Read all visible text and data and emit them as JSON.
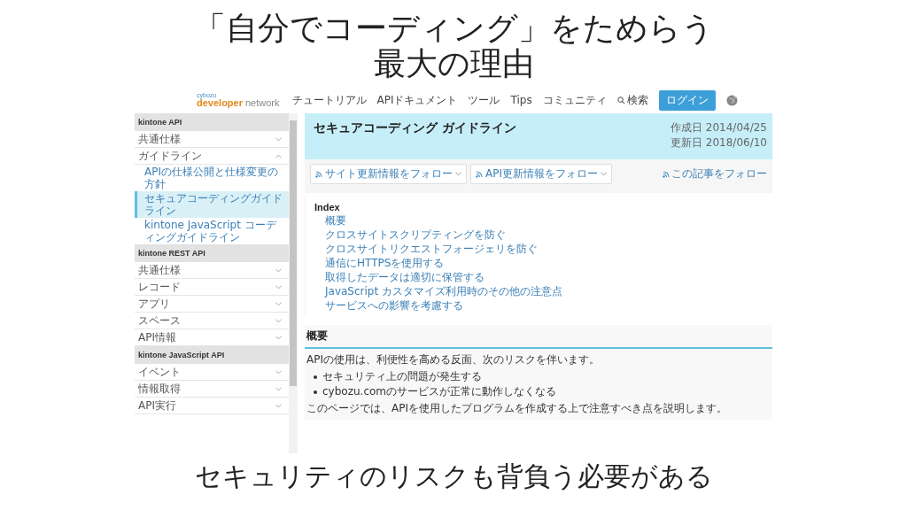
{
  "slide": {
    "title_lines": [
      "「自分でコーディング」をためらう",
      "最大の理由"
    ],
    "caption": "セキュリティのリスクも背負う必要がある"
  },
  "site": {
    "logo": {
      "company": "cybozu",
      "brand": "developer",
      "suffix": "network"
    },
    "nav": [
      "チュートリアル",
      "APIドキュメント",
      "ツール",
      "Tips",
      "コミュニティ"
    ],
    "search": "検索",
    "login": "ログイン"
  },
  "sidebar": [
    {
      "kind": "section",
      "label": "kintone API"
    },
    {
      "kind": "item",
      "label": "共通仕様",
      "expanded": false
    },
    {
      "kind": "item",
      "label": "ガイドライン",
      "expanded": true,
      "children": [
        {
          "label": "APIの仕様公開と仕様変更の方針",
          "selected": false
        },
        {
          "label": "セキュアコーディングガイドライン",
          "selected": true
        },
        {
          "label": "kintone JavaScript コーディングガイドライン",
          "selected": false
        }
      ]
    },
    {
      "kind": "section",
      "label": "kintone REST API"
    },
    {
      "kind": "item",
      "label": "共通仕様",
      "expanded": false
    },
    {
      "kind": "item",
      "label": "レコード",
      "expanded": false
    },
    {
      "kind": "item",
      "label": "アプリ",
      "expanded": false
    },
    {
      "kind": "item",
      "label": "スペース",
      "expanded": false
    },
    {
      "kind": "item",
      "label": "API情報",
      "expanded": false
    },
    {
      "kind": "section",
      "label": "kintone JavaScript API"
    },
    {
      "kind": "item",
      "label": "イベント",
      "expanded": false
    },
    {
      "kind": "item",
      "label": "情報取得",
      "expanded": false
    },
    {
      "kind": "item",
      "label": "API実行",
      "expanded": false
    }
  ],
  "article": {
    "title": "セキュアコーディング ガイドライン",
    "created": "作成日 2014/04/25",
    "updated": "更新日 2018/06/10",
    "follow_buttons": [
      "サイト更新情報をフォロー",
      "API更新情報をフォロー"
    ],
    "follow_article": "この記事をフォロー",
    "index_title": "Index",
    "index": [
      "概要",
      "クロスサイトスクリプティングを防ぐ",
      "クロスサイトリクエストフォージェリを防ぐ",
      "通信にHTTPSを使用する",
      "取得したデータは適切に保管する",
      "JavaScript カスタマイズ利用時のその他の注意点",
      "サービスへの影響を考慮する"
    ],
    "section_title": "概要",
    "intro": "APIの使用は、利便性を高める反面、次のリスクを伴います。",
    "bullets": [
      "セキュリティ上の問題が発生する",
      "cybozu.comのサービスが正常に動作しなくなる"
    ],
    "outro": "このページでは、APIを使用したプログラムを作成する上で注意すべき点を説明します。"
  }
}
